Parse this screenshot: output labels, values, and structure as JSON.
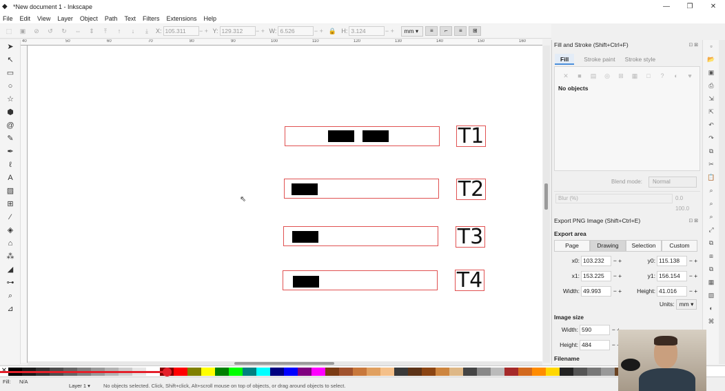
{
  "window": {
    "title": "*New document 1 - Inkscape",
    "controls": [
      "—",
      "❐",
      "✕"
    ]
  },
  "menu": [
    "File",
    "Edit",
    "View",
    "Layer",
    "Object",
    "Path",
    "Text",
    "Filters",
    "Extensions",
    "Help"
  ],
  "toolbar": {
    "x_label": "X:",
    "x_value": "105.311",
    "y_label": "Y:",
    "y_value": "129.312",
    "w_label": "W:",
    "w_value": "6.526",
    "h_label": "H:",
    "h_value": "3.124",
    "unit": "mm ▾"
  },
  "ruler_labels": [
    "40",
    "50",
    "60",
    "70",
    "80",
    "90",
    "100",
    "110",
    "120",
    "130",
    "140",
    "150",
    "160"
  ],
  "canvas": {
    "rows": [
      {
        "label": "T1"
      },
      {
        "label": "T2"
      },
      {
        "label": "T3"
      },
      {
        "label": "T4"
      }
    ]
  },
  "fill_stroke": {
    "title": "Fill and Stroke (Shift+Ctrl+F)",
    "tab_fill": "Fill",
    "tab_stroke_paint": "Stroke paint",
    "tab_stroke_style": "Stroke style",
    "no_objects": "No objects",
    "blend_label": "Blend mode:",
    "blend_value": "Normal",
    "blur_label": "Blur (%)",
    "blur_value": "0.0",
    "opacity_value": "100.0"
  },
  "export": {
    "title": "Export PNG Image (Shift+Ctrl+E)",
    "area_heading": "Export area",
    "area_buttons": [
      "Page",
      "Drawing",
      "Selection",
      "Custom"
    ],
    "x0_label": "x0:",
    "x0": "103.232",
    "y0_label": "y0:",
    "y0": "115.138",
    "x1_label": "x1:",
    "x1": "153.225",
    "y1_label": "y1:",
    "y1": "156.154",
    "width_label": "Width:",
    "width": "49.993",
    "height_label": "Height:",
    "height": "41.016",
    "units_label": "Units:",
    "units": "mm ▾",
    "image_size_heading": "Image size",
    "img_width_label": "Width:",
    "img_width": "590",
    "img_height_label": "Height:",
    "img_height": "484",
    "filename_heading": "Filename"
  },
  "status": {
    "fill_label": "Fill:",
    "fill_value": "N/A",
    "layer": "Layer 1 ▾",
    "message": "No objects selected. Click, Shift+click, Alt+scroll mouse on top of objects, or drag around objects to select."
  },
  "video": {
    "progress": 0.23
  },
  "colors": {
    "accent": "#4a8edb",
    "bbox_red": "#e05050",
    "video_red": "#e4202a"
  }
}
